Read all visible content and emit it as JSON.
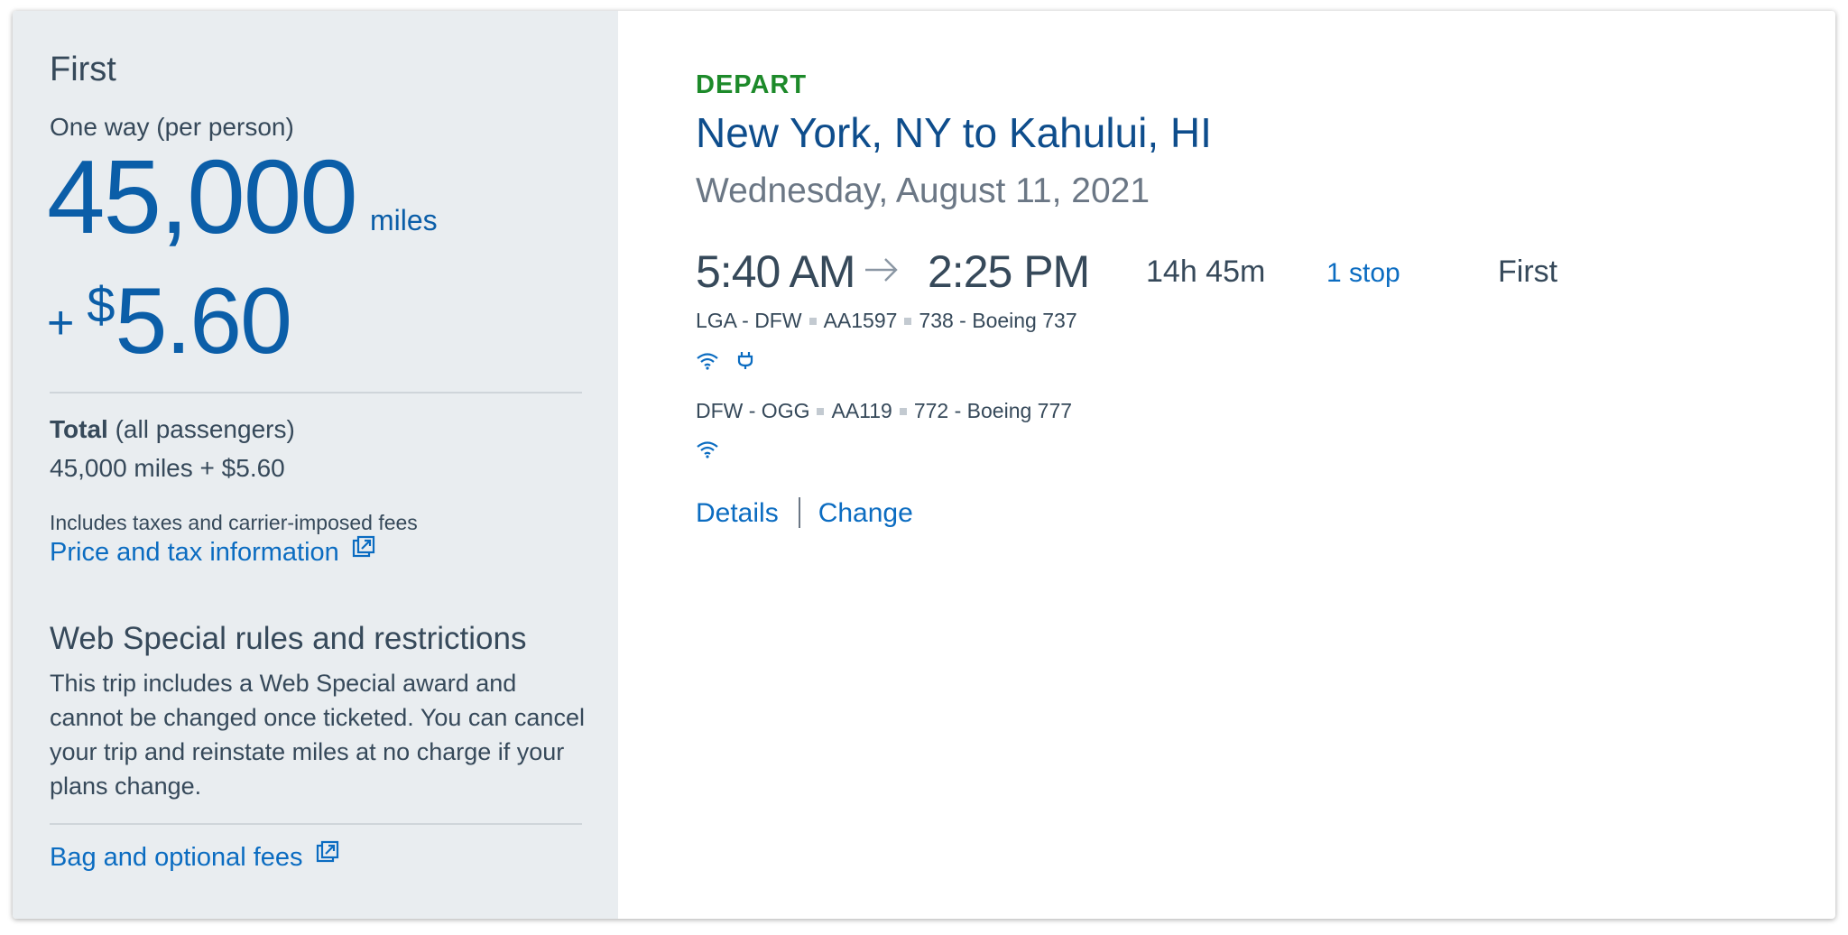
{
  "summary": {
    "cabin": "First",
    "one_way_label": "One way (per person)",
    "miles": "45,000",
    "miles_unit": "miles",
    "plus": "+",
    "currency_symbol": "$",
    "cash": "5.60",
    "total_label_bold": "Total",
    "total_label_rest": " (all passengers)",
    "total_value": "45,000 miles + $5.60",
    "includes_text": "Includes taxes and carrier-imposed fees",
    "price_link": "Price and tax information",
    "web_special_title": "Web Special rules and restrictions",
    "web_special_body": "This trip includes a Web Special award and cannot be changed once ticketed. You can cancel your trip and reinstate miles at no charge if your plans change.",
    "bag_link": "Bag and optional fees"
  },
  "flight": {
    "direction": "DEPART",
    "route": "New York, NY to Kahului, HI",
    "date": "Wednesday, August 11, 2021",
    "depart_time": "5:40 AM",
    "arrive_time": "2:25 PM",
    "duration": "14h 45m",
    "stops": "1 stop",
    "cabin": "First",
    "segments": [
      {
        "route": "LGA - DFW",
        "flight": "AA1597",
        "aircraft": "738 - Boeing 737",
        "amenities": [
          "wifi-icon",
          "power-outlet-icon"
        ]
      },
      {
        "route": "DFW - OGG",
        "flight": "AA119",
        "aircraft": "772 - Boeing 777",
        "amenities": [
          "wifi-icon"
        ]
      }
    ],
    "details_link": "Details",
    "change_link": "Change"
  },
  "colors": {
    "accent_blue": "#0b5ea8",
    "link_blue": "#0b6cc1",
    "depart_green": "#1d8a2a",
    "panel_gray": "#e9edf0"
  }
}
